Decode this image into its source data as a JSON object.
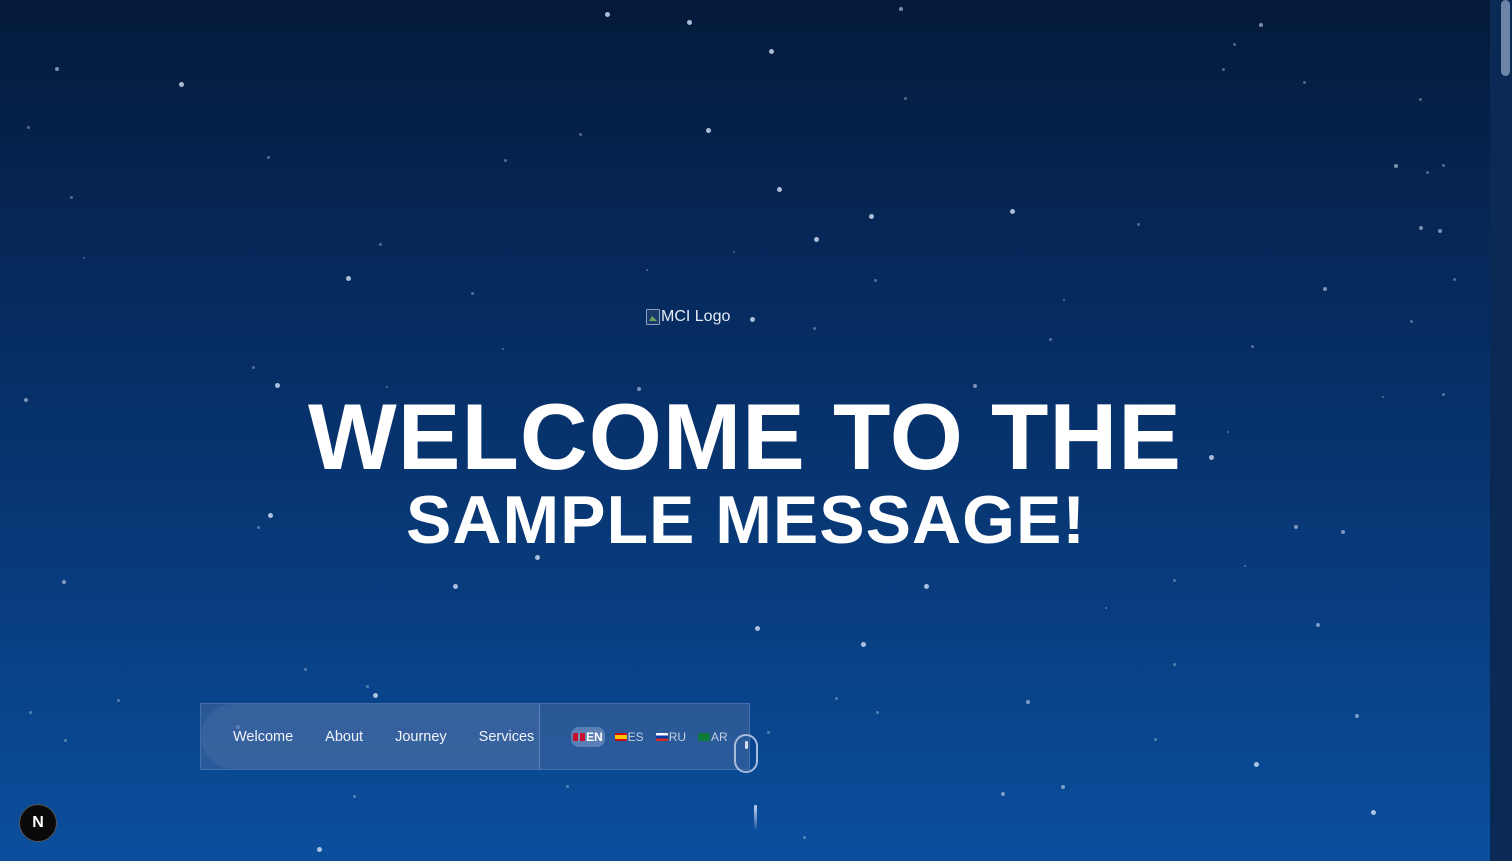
{
  "logo": {
    "alt": "MCI Logo"
  },
  "hero": {
    "line1": "WELCOME TO THE",
    "line2": "SAMPLE MESSAGE!"
  },
  "nav": {
    "links": [
      "Welcome",
      "About",
      "Journey",
      "Services"
    ]
  },
  "languages": [
    {
      "code": "EN",
      "flag": "gb-flag-icon",
      "active": true
    },
    {
      "code": "ES",
      "flag": "es-flag-icon",
      "active": false
    },
    {
      "code": "RU",
      "flag": "ru-flag-icon",
      "active": false
    },
    {
      "code": "AR",
      "flag": "sa-flag-icon",
      "active": false
    }
  ],
  "dev_badge": {
    "label": "N"
  },
  "colors": {
    "bg_top": "#041a3a",
    "bg_bottom": "#0a4f9e",
    "text": "#ffffff"
  }
}
